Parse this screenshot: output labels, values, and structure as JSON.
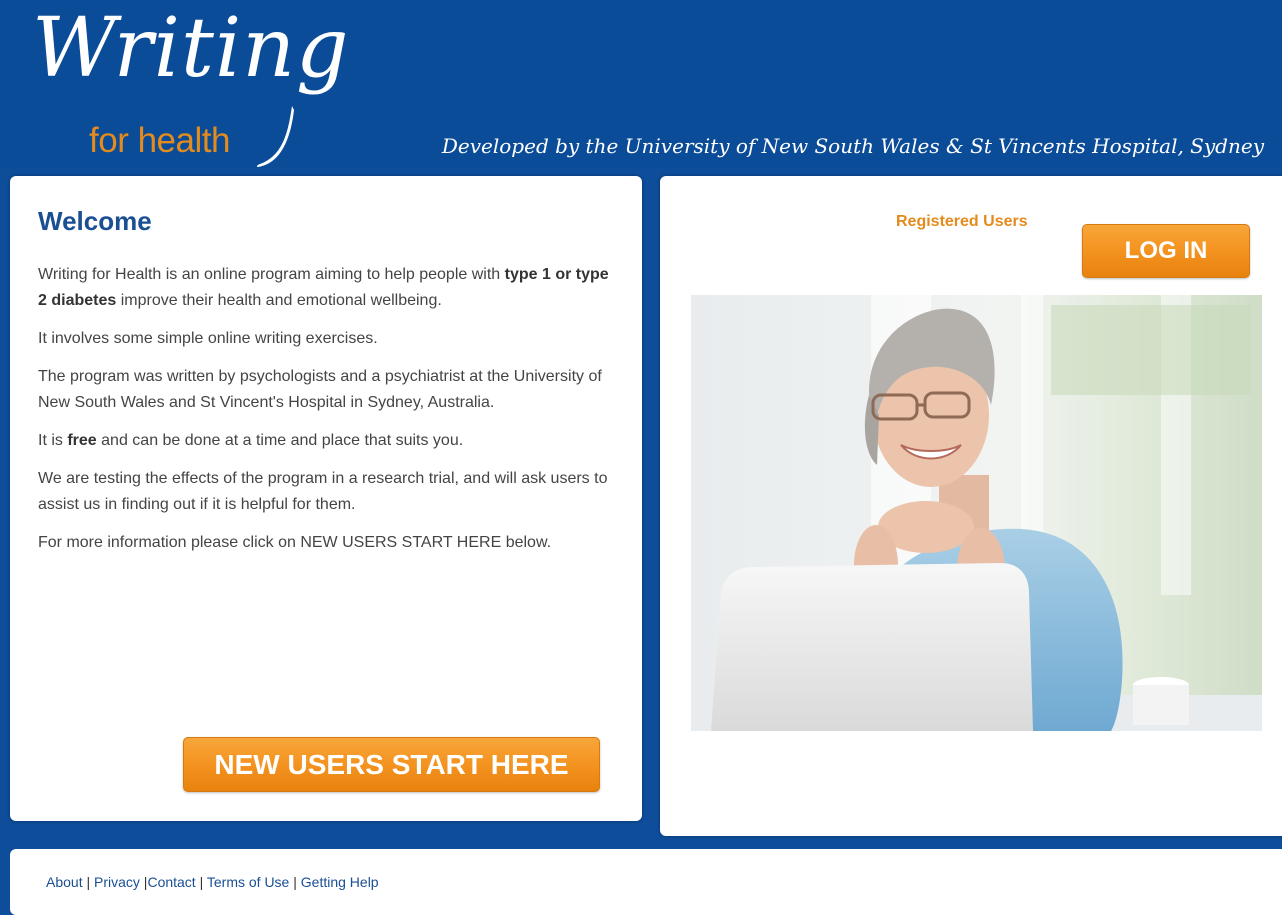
{
  "header": {
    "logo_main": "Writing",
    "logo_sub": "for health",
    "tagline": "Developed by the University of New South Wales & St Vincents Hospital, Sydney"
  },
  "welcome": {
    "title": "Welcome",
    "p1_pre": "Writing for Health is an online program aiming to help people with ",
    "p1_bold": "type 1 or type 2 diabetes",
    "p1_post": " improve their health and emotional wellbeing.",
    "p2": "It involves some simple online writing exercises.",
    "p3": "The program was written by psychologists and a psychiatrist at the University of New South Wales and St Vincent's Hospital in Sydney, Australia.",
    "p4_pre": "It is ",
    "p4_bold": "free",
    "p4_post": " and can be done at a time and place that suits you.",
    "p5": "We are testing the effects of the program in a research trial, and will ask users to assist us in finding out if it is helpful for them.",
    "p6": "For more information please click on NEW USERS START HERE below.",
    "new_users_button": "NEW USERS START HERE"
  },
  "login": {
    "registered_label": "Registered Users",
    "login_button": "LOG IN"
  },
  "footer": {
    "links": [
      "About",
      "Privacy",
      "Contact",
      "Terms of Use",
      "Getting Help"
    ],
    "separators": [
      " | ",
      " |",
      " | ",
      " | "
    ]
  },
  "colors": {
    "brand_blue": "#0b4c99",
    "accent_orange": "#f49320",
    "heading_blue": "#1a4f93"
  }
}
